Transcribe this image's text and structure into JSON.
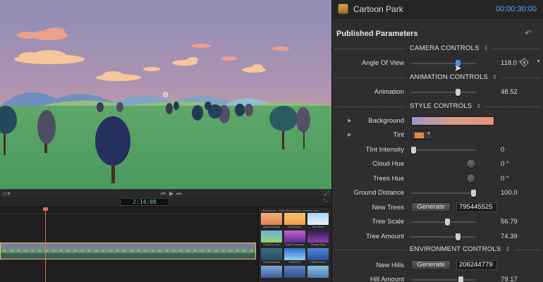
{
  "inspector": {
    "title": "Cartoon Park",
    "timecode": "00:00:30:00",
    "section_heading": "Published Parameters",
    "icons": {
      "app": "motion-template-icon",
      "reset": "reset-icon",
      "keyframe": "keyframe-diamond-icon"
    }
  },
  "sections": {
    "camera": "CAMERA CONTROLS",
    "animation": "ANIMATION CONTROLS",
    "style": "STYLE CONTROLS",
    "environment": "ENVIRONMENT CONTROLS",
    "toggle_glyph": "⇕"
  },
  "params": {
    "angle_of_view": {
      "label": "Angle Of View",
      "value": "118.0",
      "unit": "°",
      "slider_fraction": 0.74
    },
    "animation": {
      "label": "Animation",
      "value": "48.52",
      "slider_fraction": 0.74
    },
    "background": {
      "label": "Background"
    },
    "tint": {
      "label": "Tint",
      "color": "#e88a3c"
    },
    "tint_intensity": {
      "label": "TInt Intensity",
      "value": "0",
      "slider_fraction": 0.0
    },
    "cloud_hue": {
      "label": "Cloud Hue",
      "value": "0",
      "unit": "°"
    },
    "trees_hue": {
      "label": "Trees Hue",
      "value": "0",
      "unit": "°"
    },
    "ground_distance": {
      "label": "Ground Distance",
      "value": "100.0",
      "slider_fraction": 1.0
    },
    "new_trees": {
      "label": "New Trees",
      "button": "Generate",
      "seed": "795445525"
    },
    "tree_scale": {
      "label": "Tree Scale",
      "value": "56.79",
      "slider_fraction": 0.57
    },
    "tree_amount": {
      "label": "Tree Amount",
      "value": "74.39",
      "slider_fraction": 0.74
    },
    "new_hills": {
      "label": "New Hills",
      "button": "Generate",
      "seed": "206244779"
    },
    "hill_amount": {
      "label": "Hill Amount",
      "value": "79.17",
      "slider_fraction": 0.79
    }
  },
  "viewer": {
    "timecode": "2:14:08",
    "controls": [
      "⏮",
      "▶",
      "⏭"
    ]
  },
  "generators": {
    "path": "Generators · Final Film Studios · Fidders Tree",
    "items": [
      {
        "label": "Autumn Clouds",
        "color_a": "#f2b27b",
        "color_b": "#e47f55"
      },
      {
        "label": "Bari Breeze",
        "color_a": "#f6c56b",
        "color_b": "#f29d4b"
      },
      {
        "label": "Blue Skies",
        "color_a": "#a9d4f3",
        "color_b": "#e7f2fb"
      },
      {
        "label": "Cubic Fly Land",
        "color_a": "#6ab3df",
        "color_b": "#9bd36b"
      },
      {
        "label": "Digital Daydream",
        "color_a": "#c65fd0",
        "color_b": "#5a2f9b"
      },
      {
        "label": "Strange Rays",
        "color_a": "#2f1f52",
        "color_b": "#8f3fb0"
      },
      {
        "label": "Old Farmhouse",
        "color_a": "#3a6e80",
        "color_b": "#284b63"
      },
      {
        "label": "Planet Fun",
        "color_a": "#2e6cd5",
        "color_b": "#8fd4f2"
      },
      {
        "label": "Planet Future",
        "color_a": "#4f8bd6",
        "color_b": "#2a4e9b"
      },
      {
        "label": "",
        "color_a": "#7fa7d6",
        "color_b": "#3c5f99"
      },
      {
        "label": "",
        "color_a": "#5f83c2",
        "color_b": "#314e86"
      },
      {
        "label": "",
        "color_a": "#8dbfdc",
        "color_b": "#4c7fb0"
      }
    ]
  }
}
